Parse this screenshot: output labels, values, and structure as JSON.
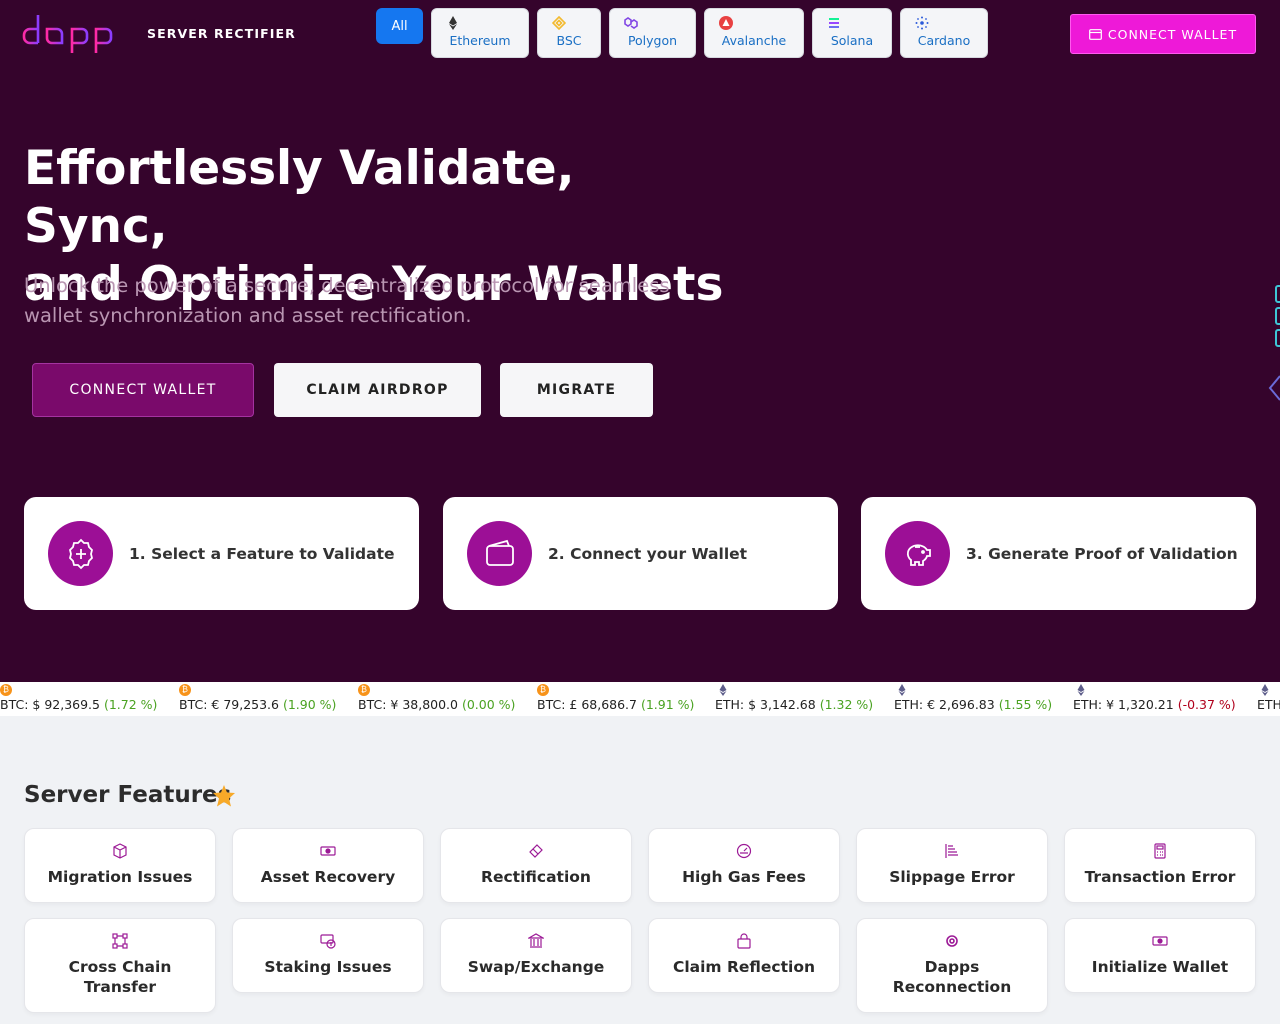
{
  "header": {
    "brand": "dapp",
    "subtitle": "SERVER RECTIFIER",
    "connect_label": "CONNECT WALLET",
    "chain_tabs": [
      {
        "label": "All",
        "icon": "all-icon",
        "active": true
      },
      {
        "label": "Ethereum",
        "icon": "ethereum-icon"
      },
      {
        "label": "BSC",
        "icon": "bsc-icon"
      },
      {
        "label": "Polygon",
        "icon": "polygon-icon"
      },
      {
        "label": "Avalanche",
        "icon": "avalanche-icon"
      },
      {
        "label": "Solana",
        "icon": "solana-icon"
      },
      {
        "label": "Cardano",
        "icon": "cardano-icon"
      }
    ]
  },
  "hero": {
    "title_line1": "Effortlessly Validate, Sync,",
    "title_line2": "and Optimize Your Wallets",
    "subtitle": "Unlock the power of a secure, decentralized protocol for seamless wallet synchronization and asset rectification.",
    "buttons": {
      "connect": "CONNECT WALLET",
      "airdrop": "CLAIM AIRDROP",
      "migrate": "MIGRATE"
    },
    "steps": [
      {
        "label": "1. Select a Feature to Validate",
        "icon": "gear-plus-icon"
      },
      {
        "label": "2. Connect your Wallet",
        "icon": "wallet-icon"
      },
      {
        "label": "3. Generate Proof of Validation",
        "icon": "piggy-bank-icon"
      }
    ]
  },
  "ticker": [
    {
      "coin": "BTC",
      "text": "BTC: $ 92,369.5 ",
      "change": "(1.72 %)",
      "dir": "pos"
    },
    {
      "coin": "BTC",
      "text": "BTC: € 79,253.6 ",
      "change": "(1.90 %)",
      "dir": "pos"
    },
    {
      "coin": "BTC",
      "text": "BTC: ¥ 38,800.0 ",
      "change": "(0.00 %)",
      "dir": "pos"
    },
    {
      "coin": "BTC",
      "text": "BTC: £ 68,686.7 ",
      "change": "(1.91 %)",
      "dir": "pos"
    },
    {
      "coin": "ETH",
      "text": "ETH: $ 3,142.68 ",
      "change": "(1.32 %)",
      "dir": "pos"
    },
    {
      "coin": "ETH",
      "text": "ETH: € 2,696.83 ",
      "change": "(1.55 %)",
      "dir": "pos"
    },
    {
      "coin": "ETH",
      "text": "ETH: ¥ 1,320.21 ",
      "change": "(-0.37 %)",
      "dir": "neg"
    },
    {
      "coin": "ETH",
      "text": "ETH",
      "change": "",
      "dir": "pos"
    }
  ],
  "features": {
    "title": "Server Features",
    "items": [
      {
        "label": "Migration Issues",
        "icon": "box-icon"
      },
      {
        "label": "Asset Recovery",
        "icon": "cash-icon"
      },
      {
        "label": "Rectification",
        "icon": "eraser-icon"
      },
      {
        "label": "High Gas Fees",
        "icon": "speedometer-icon"
      },
      {
        "label": "Slippage Error",
        "icon": "bar-list-icon"
      },
      {
        "label": "Transaction Error",
        "icon": "calculator-icon"
      },
      {
        "label": "Cross Chain Transfer",
        "icon": "nodes-icon"
      },
      {
        "label": "Staking Issues",
        "icon": "coins-icon"
      },
      {
        "label": "Swap/Exchange",
        "icon": "bank-icon"
      },
      {
        "label": "Claim Reflection",
        "icon": "bag-icon"
      },
      {
        "label": "Dapps Reconnection",
        "icon": "cog-icon"
      },
      {
        "label": "Initialize Wallet",
        "icon": "cash-icon"
      }
    ]
  },
  "colors": {
    "hero_bg": "#35042c",
    "accent_magenta": "#ee19d8",
    "step_icon_bg": "#9c0f96",
    "active_tab": "#1577f0",
    "positive": "#4aa221",
    "negative": "#b0001c"
  }
}
